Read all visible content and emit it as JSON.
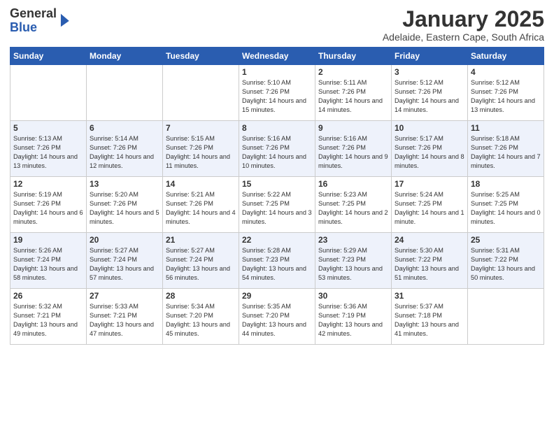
{
  "header": {
    "logo_general": "General",
    "logo_blue": "Blue",
    "month_title": "January 2025",
    "location": "Adelaide, Eastern Cape, South Africa"
  },
  "days_of_week": [
    "Sunday",
    "Monday",
    "Tuesday",
    "Wednesday",
    "Thursday",
    "Friday",
    "Saturday"
  ],
  "weeks": [
    [
      {
        "day": "",
        "info": ""
      },
      {
        "day": "",
        "info": ""
      },
      {
        "day": "",
        "info": ""
      },
      {
        "day": "1",
        "info": "Sunrise: 5:10 AM\nSunset: 7:26 PM\nDaylight: 14 hours and 15 minutes."
      },
      {
        "day": "2",
        "info": "Sunrise: 5:11 AM\nSunset: 7:26 PM\nDaylight: 14 hours and 14 minutes."
      },
      {
        "day": "3",
        "info": "Sunrise: 5:12 AM\nSunset: 7:26 PM\nDaylight: 14 hours and 14 minutes."
      },
      {
        "day": "4",
        "info": "Sunrise: 5:12 AM\nSunset: 7:26 PM\nDaylight: 14 hours and 13 minutes."
      }
    ],
    [
      {
        "day": "5",
        "info": "Sunrise: 5:13 AM\nSunset: 7:26 PM\nDaylight: 14 hours and 13 minutes."
      },
      {
        "day": "6",
        "info": "Sunrise: 5:14 AM\nSunset: 7:26 PM\nDaylight: 14 hours and 12 minutes."
      },
      {
        "day": "7",
        "info": "Sunrise: 5:15 AM\nSunset: 7:26 PM\nDaylight: 14 hours and 11 minutes."
      },
      {
        "day": "8",
        "info": "Sunrise: 5:16 AM\nSunset: 7:26 PM\nDaylight: 14 hours and 10 minutes."
      },
      {
        "day": "9",
        "info": "Sunrise: 5:16 AM\nSunset: 7:26 PM\nDaylight: 14 hours and 9 minutes."
      },
      {
        "day": "10",
        "info": "Sunrise: 5:17 AM\nSunset: 7:26 PM\nDaylight: 14 hours and 8 minutes."
      },
      {
        "day": "11",
        "info": "Sunrise: 5:18 AM\nSunset: 7:26 PM\nDaylight: 14 hours and 7 minutes."
      }
    ],
    [
      {
        "day": "12",
        "info": "Sunrise: 5:19 AM\nSunset: 7:26 PM\nDaylight: 14 hours and 6 minutes."
      },
      {
        "day": "13",
        "info": "Sunrise: 5:20 AM\nSunset: 7:26 PM\nDaylight: 14 hours and 5 minutes."
      },
      {
        "day": "14",
        "info": "Sunrise: 5:21 AM\nSunset: 7:26 PM\nDaylight: 14 hours and 4 minutes."
      },
      {
        "day": "15",
        "info": "Sunrise: 5:22 AM\nSunset: 7:25 PM\nDaylight: 14 hours and 3 minutes."
      },
      {
        "day": "16",
        "info": "Sunrise: 5:23 AM\nSunset: 7:25 PM\nDaylight: 14 hours and 2 minutes."
      },
      {
        "day": "17",
        "info": "Sunrise: 5:24 AM\nSunset: 7:25 PM\nDaylight: 14 hours and 1 minute."
      },
      {
        "day": "18",
        "info": "Sunrise: 5:25 AM\nSunset: 7:25 PM\nDaylight: 14 hours and 0 minutes."
      }
    ],
    [
      {
        "day": "19",
        "info": "Sunrise: 5:26 AM\nSunset: 7:24 PM\nDaylight: 13 hours and 58 minutes."
      },
      {
        "day": "20",
        "info": "Sunrise: 5:27 AM\nSunset: 7:24 PM\nDaylight: 13 hours and 57 minutes."
      },
      {
        "day": "21",
        "info": "Sunrise: 5:27 AM\nSunset: 7:24 PM\nDaylight: 13 hours and 56 minutes."
      },
      {
        "day": "22",
        "info": "Sunrise: 5:28 AM\nSunset: 7:23 PM\nDaylight: 13 hours and 54 minutes."
      },
      {
        "day": "23",
        "info": "Sunrise: 5:29 AM\nSunset: 7:23 PM\nDaylight: 13 hours and 53 minutes."
      },
      {
        "day": "24",
        "info": "Sunrise: 5:30 AM\nSunset: 7:22 PM\nDaylight: 13 hours and 51 minutes."
      },
      {
        "day": "25",
        "info": "Sunrise: 5:31 AM\nSunset: 7:22 PM\nDaylight: 13 hours and 50 minutes."
      }
    ],
    [
      {
        "day": "26",
        "info": "Sunrise: 5:32 AM\nSunset: 7:21 PM\nDaylight: 13 hours and 49 minutes."
      },
      {
        "day": "27",
        "info": "Sunrise: 5:33 AM\nSunset: 7:21 PM\nDaylight: 13 hours and 47 minutes."
      },
      {
        "day": "28",
        "info": "Sunrise: 5:34 AM\nSunset: 7:20 PM\nDaylight: 13 hours and 45 minutes."
      },
      {
        "day": "29",
        "info": "Sunrise: 5:35 AM\nSunset: 7:20 PM\nDaylight: 13 hours and 44 minutes."
      },
      {
        "day": "30",
        "info": "Sunrise: 5:36 AM\nSunset: 7:19 PM\nDaylight: 13 hours and 42 minutes."
      },
      {
        "day": "31",
        "info": "Sunrise: 5:37 AM\nSunset: 7:18 PM\nDaylight: 13 hours and 41 minutes."
      },
      {
        "day": "",
        "info": ""
      }
    ]
  ]
}
